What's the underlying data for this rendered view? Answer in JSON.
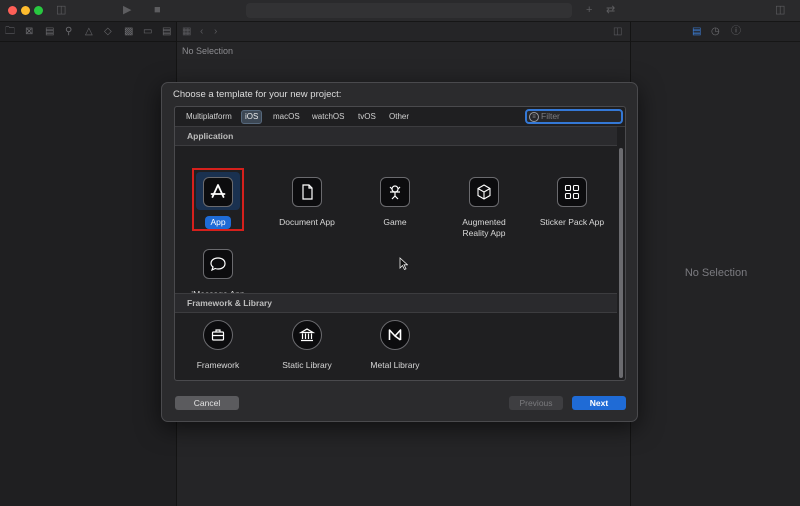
{
  "colors": {
    "accent": "#1f6bd6",
    "focus_ring": "#3478d6",
    "selection_box": "#d6201c",
    "close": "#fe5f57",
    "minimize": "#febc2e",
    "zoom": "#28c840"
  },
  "editor": {
    "no_selection": "No Selection"
  },
  "inspector": {
    "no_selection": "No Selection"
  },
  "sheet": {
    "title": "Choose a template for your new project:",
    "tabs": [
      {
        "label": "Multiplatform",
        "selected": false
      },
      {
        "label": "iOS",
        "selected": true
      },
      {
        "label": "macOS",
        "selected": false
      },
      {
        "label": "watchOS",
        "selected": false
      },
      {
        "label": "tvOS",
        "selected": false
      },
      {
        "label": "Other",
        "selected": false
      }
    ],
    "filter": {
      "placeholder": "Filter",
      "icon": "filter-icon"
    },
    "sections": [
      {
        "title": "Application",
        "templates": [
          {
            "label": "App",
            "icon": "app-store-icon",
            "selected": true
          },
          {
            "label": "Document App",
            "icon": "document-icon",
            "selected": false
          },
          {
            "label": "Game",
            "icon": "game-sprite-icon",
            "selected": false
          },
          {
            "label": "Augmented Reality App",
            "icon": "ar-cube-icon",
            "selected": false
          },
          {
            "label": "Sticker Pack App",
            "icon": "sticker-grid-icon",
            "selected": false
          },
          {
            "label": "iMessage App",
            "icon": "message-bubble-icon",
            "selected": false
          }
        ]
      },
      {
        "title": "Framework & Library",
        "templates": [
          {
            "label": "Framework",
            "icon": "framework-toolbox-icon",
            "selected": false
          },
          {
            "label": "Static Library",
            "icon": "library-building-icon",
            "selected": false
          },
          {
            "label": "Metal Library",
            "icon": "metal-icon",
            "selected": false
          }
        ]
      }
    ],
    "buttons": {
      "cancel": "Cancel",
      "previous": "Previous",
      "next": "Next"
    }
  }
}
